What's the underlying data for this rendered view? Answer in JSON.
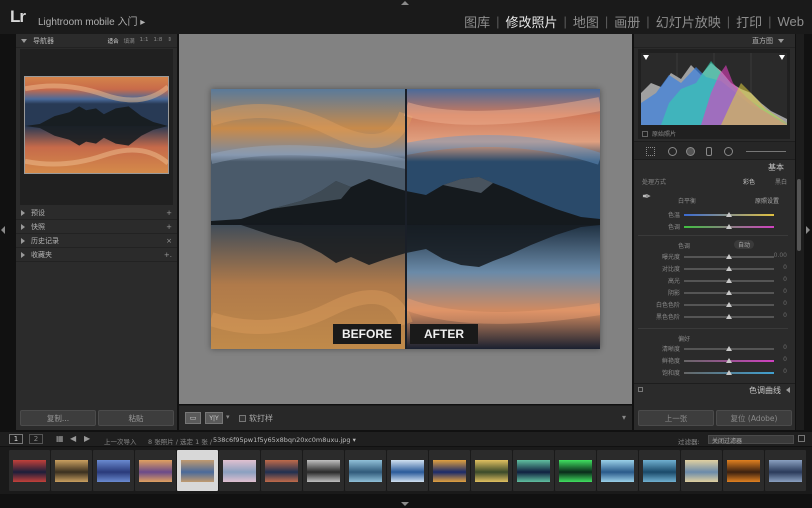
{
  "app": {
    "logo": "Lr",
    "name": "Lightroom mobile 入门 ▸"
  },
  "modules": [
    {
      "label": "图库",
      "active": false
    },
    {
      "label": "修改照片",
      "active": true
    },
    {
      "label": "地图",
      "active": false
    },
    {
      "label": "画册",
      "active": false
    },
    {
      "label": "幻灯片放映",
      "active": false
    },
    {
      "label": "打印",
      "active": false
    },
    {
      "label": "Web",
      "active": false
    }
  ],
  "left": {
    "navigator": {
      "title": "导航器",
      "zooms": [
        "适合",
        "填满",
        "1:1",
        "1:8"
      ]
    },
    "panels": [
      {
        "label": "预设",
        "action": "+"
      },
      {
        "label": "快照",
        "action": "+"
      },
      {
        "label": "历史记录",
        "action": "×"
      },
      {
        "label": "收藏夹",
        "action": "+."
      }
    ],
    "copy_button": "复制...",
    "paste_button": "粘贴"
  },
  "center": {
    "before_label": "BEFORE",
    "after_label": "AFTER",
    "view_mode": "Y|Y",
    "soft_proof": "软打样"
  },
  "right": {
    "histogram_title": "直方图",
    "original_photo": "原始照片",
    "basic_title": "基本",
    "treatment": {
      "label": "处理方式",
      "color": "彩色",
      "bw": "黑白"
    },
    "wb": {
      "label": "白平衡",
      "value": "原照设置"
    },
    "sliders": [
      {
        "label": "色温",
        "pos": 0.5
      },
      {
        "label": "色调",
        "pos": 0.5
      }
    ],
    "tone": {
      "label": "色调",
      "auto": "自动"
    },
    "tone_sliders": [
      {
        "label": "曝光度",
        "pos": 0.5,
        "val": "0.00"
      },
      {
        "label": "对比度",
        "pos": 0.5,
        "val": "0"
      },
      {
        "label": "高光",
        "pos": 0.5,
        "val": "0"
      },
      {
        "label": "阴影",
        "pos": 0.5,
        "val": "0"
      },
      {
        "label": "白色色阶",
        "pos": 0.5,
        "val": "0"
      },
      {
        "label": "黑色色阶",
        "pos": 0.5,
        "val": "0"
      }
    ],
    "presence": "偏好",
    "presence_sliders": [
      {
        "label": "清晰度",
        "pos": 0.5,
        "val": "0"
      },
      {
        "label": "鲜艳度",
        "pos": 0.5,
        "val": "0"
      },
      {
        "label": "饱和度",
        "pos": 0.5,
        "val": "0"
      }
    ],
    "tone_curve": "色调曲线",
    "prev_button": "上一张",
    "reset_button": "复位 (Adobe)"
  },
  "filmbar": {
    "page1": "1",
    "page2": "2",
    "source": "上一次导入",
    "count": "8 张照片 / 选定 1 张 /",
    "filename": "538c6f95pw1f5y65x8bqn20xc0m8uxu.jpg ▾",
    "filter_label": "过滤器:",
    "filter_value": "关闭过滤器"
  },
  "filmstrip": {
    "selected_index": 4,
    "thumbs": [
      [
        "#1b1e3a",
        "#c2403a"
      ],
      [
        "#3a3020",
        "#caa060"
      ],
      [
        "#2a3a7a",
        "#6a8ad0"
      ],
      [
        "#6a4a8a",
        "#e0a060"
      ],
      [
        "#4a6a9a",
        "#c09a70"
      ],
      [
        "#8aa0c0",
        "#e0c0d0"
      ],
      [
        "#203050",
        "#c06a4a"
      ],
      [
        "#2a2a2a",
        "#c0c0c0"
      ],
      [
        "#305a7a",
        "#90c0d8"
      ],
      [
        "#2a5a9a",
        "#d0e0f0"
      ],
      [
        "#1a2a6a",
        "#e0a040"
      ],
      [
        "#3a4a2a",
        "#e0c060"
      ],
      [
        "#102040",
        "#60c0a0"
      ],
      [
        "#0a2a1a",
        "#40e060"
      ],
      [
        "#2a5a8a",
        "#9ad0e8"
      ],
      [
        "#1a4a6a",
        "#70b0d0"
      ],
      [
        "#6a8aaa",
        "#e0d0a0"
      ],
      [
        "#3a2010",
        "#e08020"
      ],
      [
        "#2a3a5a",
        "#8aa0c0"
      ]
    ]
  }
}
